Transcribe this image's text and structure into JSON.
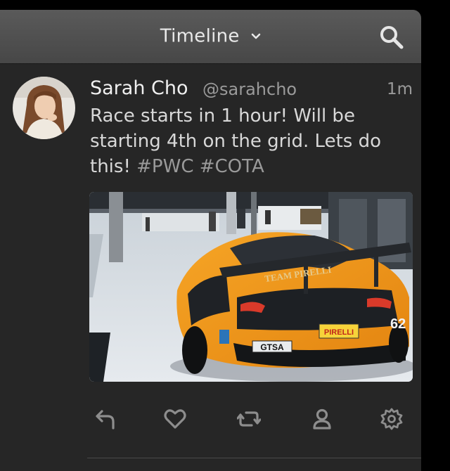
{
  "header": {
    "title": "Timeline"
  },
  "tweet": {
    "name": "Sarah Cho",
    "handle": "@sarahcho",
    "time": "1m",
    "text": "Race starts in 1 hour! Will be starting 4th on the grid. Lets do this!",
    "hashtags": [
      "#PWC",
      "#COTA"
    ],
    "photo": {
      "rear_badge": "GTSA",
      "plate": "PIRELLI",
      "number": "62",
      "wing_text": "TEAM PIRELLI"
    }
  },
  "actions": [
    "reply-icon",
    "like-icon",
    "retweet-icon",
    "profile-icon",
    "settings-icon"
  ]
}
